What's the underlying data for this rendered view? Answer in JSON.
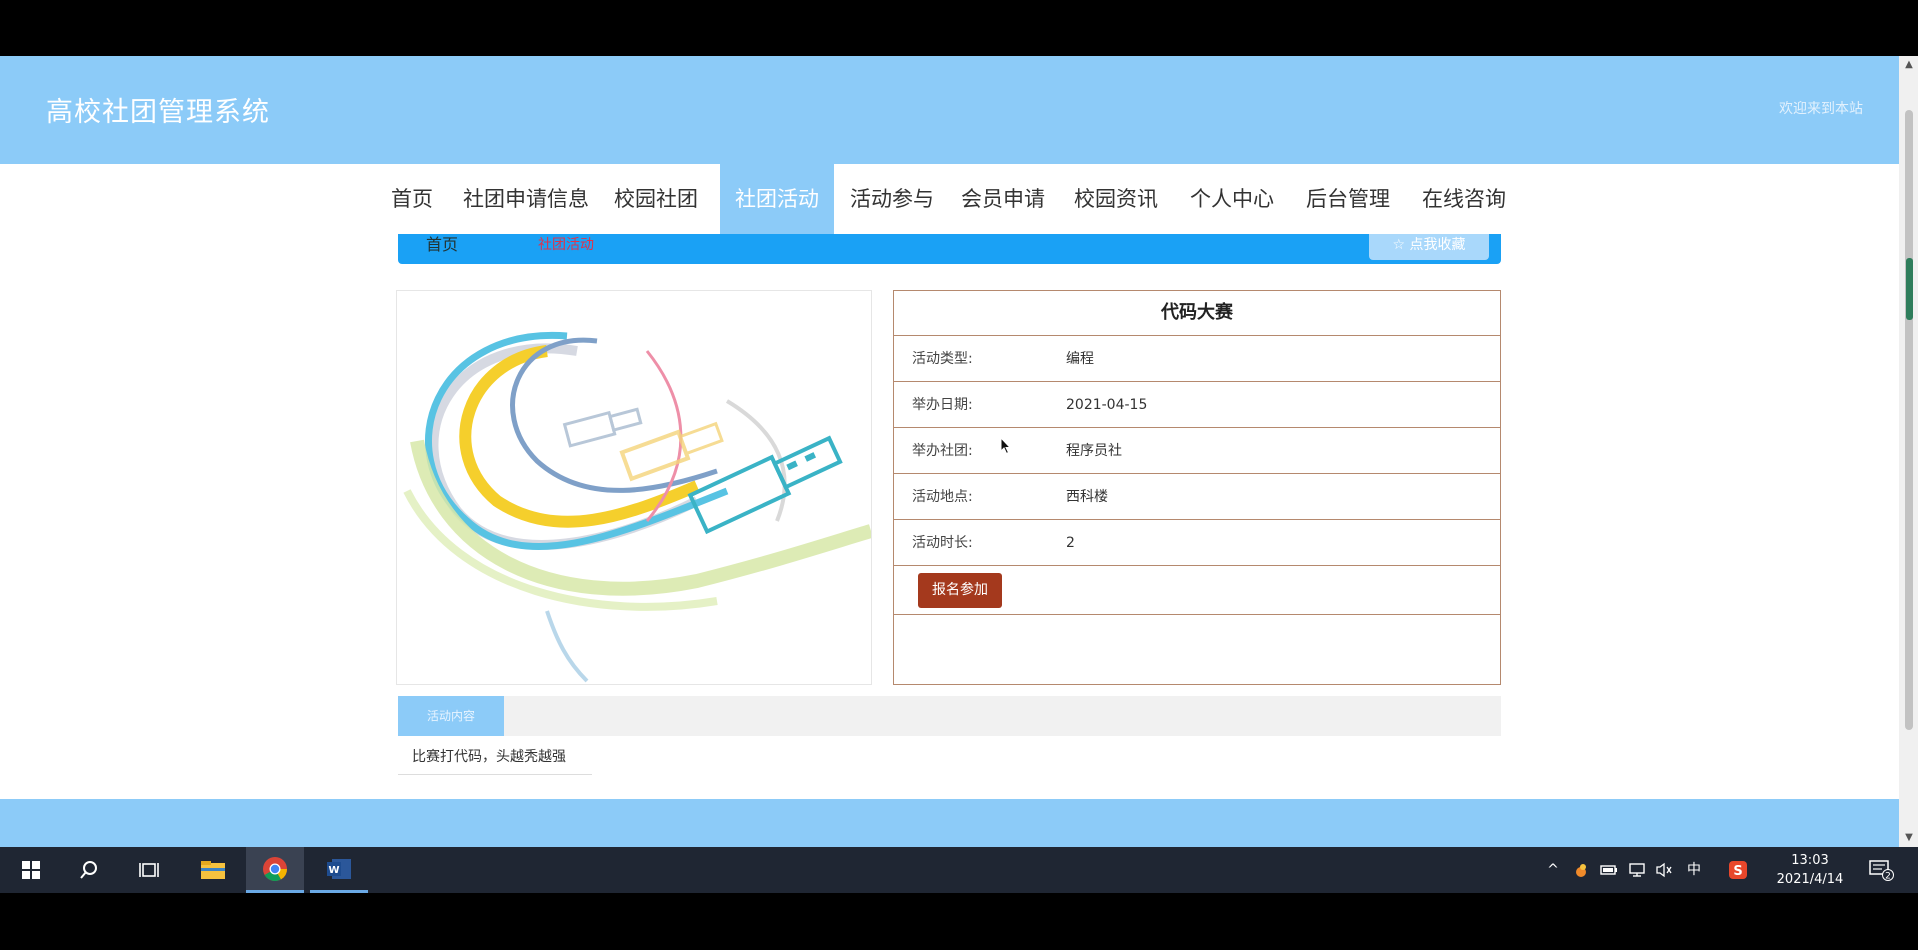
{
  "site": {
    "title": "高校社团管理系统",
    "welcome": "欢迎来到本站"
  },
  "nav": {
    "items": [
      "首页",
      "社团申请信息",
      "校园社团",
      "社团活动",
      "活动参与",
      "会员申请",
      "校园资讯",
      "个人中心",
      "后台管理",
      "在线咨询"
    ],
    "active": "社团活动"
  },
  "breadcrumb": {
    "home": "首页",
    "current": "社团活动",
    "favorite": "☆ 点我收藏"
  },
  "event": {
    "title": "代码大赛",
    "rows": [
      {
        "label": "活动类型:",
        "value": "编程"
      },
      {
        "label": "举办日期:",
        "value": "2021-04-15"
      },
      {
        "label": "举办社团:",
        "value": "程序员社"
      },
      {
        "label": "活动地点:",
        "value": "西科楼"
      },
      {
        "label": "活动时长:",
        "value": "2"
      }
    ],
    "join_label": "报名参加"
  },
  "content": {
    "tab_label": "活动内容",
    "description": "比赛打代码，头越秃越强"
  },
  "taskbar": {
    "time": "13:03",
    "date": "2021/4/14",
    "ime": "中",
    "notifications": "2",
    "apps": [
      "start-icon",
      "search-icon",
      "task-view-icon",
      "file-explorer-icon",
      "chrome-icon",
      "word-icon"
    ]
  },
  "colors": {
    "header": "#8ccbf8",
    "breadcrumb_bar": "#1aa1f5",
    "join_button": "#a4391d",
    "info_border": "#b5896e",
    "taskbar": "#1f2633"
  }
}
